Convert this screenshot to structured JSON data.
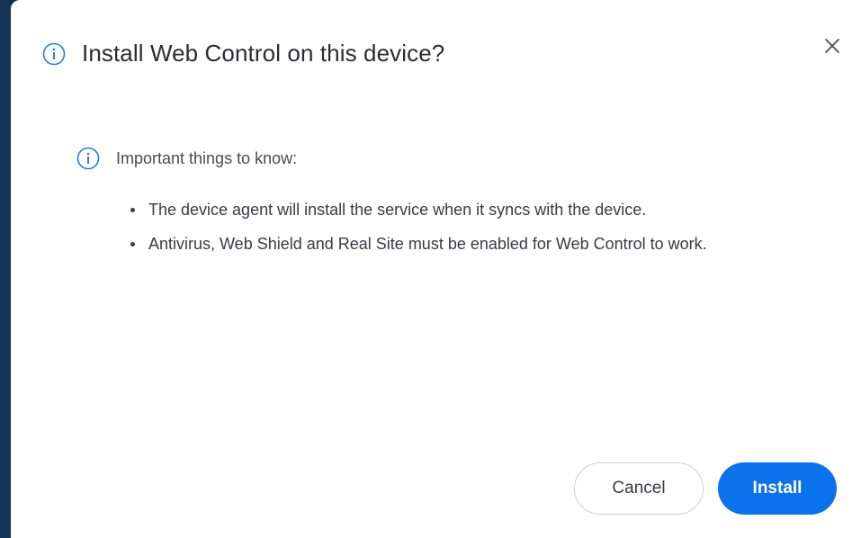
{
  "dialog": {
    "title": "Install Web Control on this device?",
    "icon": "info-icon",
    "close_icon": "close-icon",
    "notice": {
      "icon": "info-icon",
      "heading": "Important things to know:",
      "items": [
        "The device agent will install the service when it syncs with the device.",
        "Antivirus, Web Shield and Real Site must be enabled for Web Control to work."
      ]
    },
    "buttons": {
      "cancel_label": "Cancel",
      "install_label": "Install"
    }
  },
  "colors": {
    "backdrop": "#0f2a47",
    "accent": "#0a72ea",
    "info_icon": "#2c7bd8",
    "text": "#2b2b33"
  }
}
